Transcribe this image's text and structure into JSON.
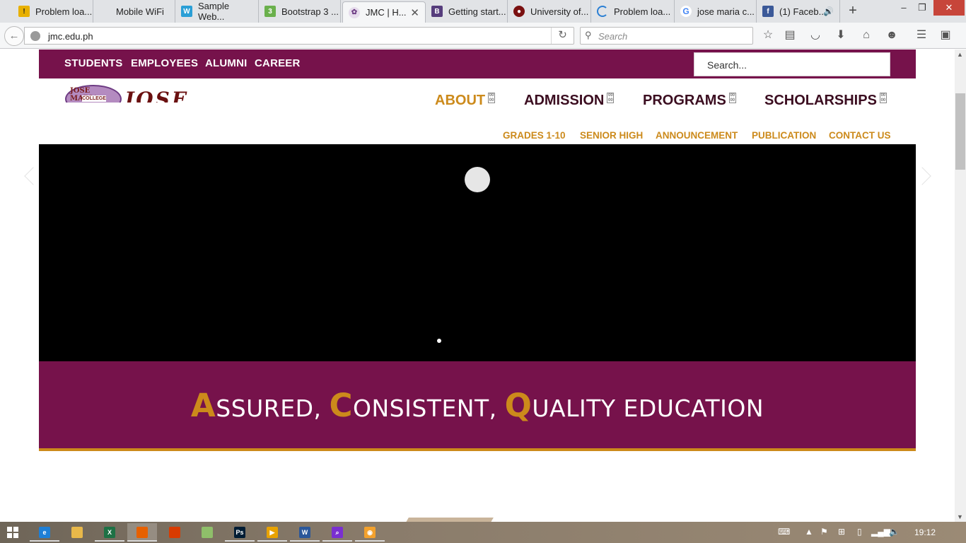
{
  "browser": {
    "tabs": [
      {
        "label": "Problem loa...",
        "icon": "warning-icon",
        "color": "#e8b000"
      },
      {
        "label": "Mobile WiFi",
        "icon": "blank-page-icon",
        "color": "#cccccc"
      },
      {
        "label": "Sample Web...",
        "icon": "w3schools-icon",
        "color": "#2b9fd6"
      },
      {
        "label": "Bootstrap 3 ...",
        "icon": "w3-green-icon",
        "color": "#6ab04c"
      },
      {
        "label": "JMC | H...",
        "icon": "jmc-seal-icon",
        "color": "#6d3b83",
        "active": true
      },
      {
        "label": "Getting start...",
        "icon": "bootstrap-icon",
        "color": "#563d7c"
      },
      {
        "label": "University of...",
        "icon": "university-seal-icon",
        "color": "#7a1010"
      },
      {
        "label": "Problem loa...",
        "icon": "loading-spinner-icon",
        "color": "#2a7fd4"
      },
      {
        "label": "jose maria c...",
        "icon": "google-icon",
        "color": "#4285f4"
      },
      {
        "label": "(1) Faceb...",
        "icon": "facebook-icon",
        "color": "#3b5998"
      }
    ],
    "new_tab_symbol": "+",
    "window_controls": {
      "minimize": "–",
      "restore": "❐",
      "close": "✕"
    },
    "url": "jmc.edu.ph",
    "search_placeholder": "Search"
  },
  "site": {
    "top_links": [
      "STUDENTS",
      "EMPLOYEES",
      "ALUMNI",
      "CAREER"
    ],
    "search_placeholder": "Search...",
    "logo": {
      "seal_text": "JOSE MARIA",
      "seal_sub": "COLLEGE",
      "name": "JOSE MARIA"
    },
    "main_nav": [
      {
        "label": "ABOUT",
        "active": true
      },
      {
        "label": "ADMISSION",
        "active": false
      },
      {
        "label": "PROGRAMS",
        "active": false
      },
      {
        "label": "SCHOLARSHIPS",
        "active": false
      }
    ],
    "sub_nav": [
      "GRADES 1-10",
      "SENIOR HIGH",
      "ANNOUNCEMENT",
      "PUBLICATION",
      "CONTACT US"
    ],
    "tagline": {
      "w1_initial": "A",
      "w1_rest": "SSURED, ",
      "w2_initial": "C",
      "w2_rest": "ONSISTENT, ",
      "w3_initial": "Q",
      "w3_rest": "UALITY EDUCATION"
    },
    "colors": {
      "maroon": "#76124b",
      "gold": "#cc8a1b",
      "dark_maroon": "#3b0d20"
    }
  },
  "taskbar": {
    "apps": [
      {
        "name": "internet-explorer-icon",
        "label": "e",
        "color": "#1e7fd6"
      },
      {
        "name": "file-explorer-icon",
        "label": "",
        "color": "#e8b84a"
      },
      {
        "name": "excel-icon",
        "label": "X",
        "color": "#1e7145"
      },
      {
        "name": "firefox-icon",
        "label": "",
        "color": "#e66000"
      },
      {
        "name": "office-icon",
        "label": "",
        "color": "#d83b01"
      },
      {
        "name": "folder-icon",
        "label": "",
        "color": "#8fbf6a"
      },
      {
        "name": "photoshop-icon",
        "label": "Ps",
        "color": "#001d34"
      },
      {
        "name": "media-player-icon",
        "label": "▶",
        "color": "#e8a200"
      },
      {
        "name": "word-icon",
        "label": "W",
        "color": "#2b579a"
      },
      {
        "name": "search-tool-icon",
        "label": "⌕",
        "color": "#7a2fd0"
      },
      {
        "name": "camera-icon",
        "label": "◉",
        "color": "#f3a12d"
      }
    ],
    "clock": "19:12"
  }
}
